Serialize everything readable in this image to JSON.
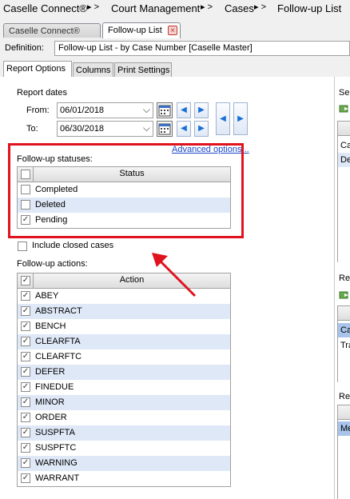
{
  "breadcrumb": {
    "items": [
      "Caselle Connect®",
      "Court Management",
      "Cases",
      "Follow-up List"
    ],
    "separator": "▸ >"
  },
  "tabs": {
    "items": [
      "Caselle Connect®",
      "Follow-up List"
    ],
    "close_icon": "close-icon"
  },
  "definition": {
    "label": "Definition:",
    "value": "Follow-up List - by Case Number [Caselle Master]"
  },
  "subtabs": [
    "Report Options",
    "Columns",
    "Print Settings"
  ],
  "report_dates": {
    "title": "Report dates",
    "from_label": "From:",
    "from_value": "06/01/2018",
    "to_label": "To:",
    "to_value": "06/30/2018"
  },
  "advanced_link": "Advanced options...",
  "statuses": {
    "title": "Follow-up statuses:",
    "header": "Status",
    "rows": [
      {
        "label": "Completed",
        "checked": false
      },
      {
        "label": "Deleted",
        "checked": false
      },
      {
        "label": "Pending",
        "checked": true
      }
    ]
  },
  "include_closed": {
    "label": "Include closed cases",
    "checked": false
  },
  "actions": {
    "title": "Follow-up actions:",
    "header": "Action",
    "rows": [
      "ABEY",
      "ABSTRACT",
      "BENCH",
      "CLEARFTA",
      "CLEARFTC",
      "DEFER",
      "FINEDUE",
      "MINOR",
      "ORDER",
      "SUSPFTA",
      "SUSPFTC",
      "WARNING",
      "WARRANT"
    ]
  },
  "right_panel": {
    "sel_label": "Sel",
    "rows1": [
      "Ca",
      "De"
    ],
    "rep_label_1": "Rep",
    "rows2": [
      "Ca",
      "Tra"
    ],
    "rep_label_2": "Rep",
    "rows3": [
      "Me"
    ]
  },
  "colors": {
    "accent_red": "#e0121d",
    "row_alt": "#dfe8f7",
    "link": "#1a46c8",
    "selected_row": "#a9c4ea"
  }
}
